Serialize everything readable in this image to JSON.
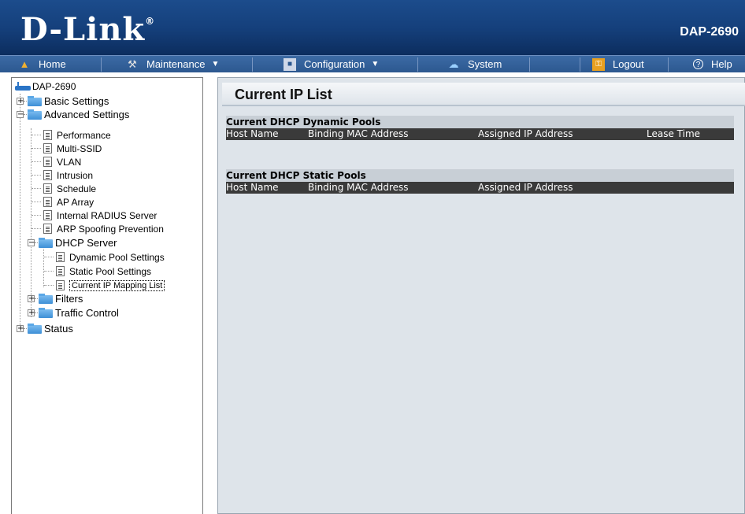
{
  "header": {
    "logo": "D-Link",
    "registered_mark": "®",
    "model": "DAP-2690"
  },
  "menubar": {
    "home": "Home",
    "maintenance": "Maintenance",
    "configuration": "Configuration",
    "system": "System",
    "logout": "Logout",
    "help": "Help"
  },
  "tree": {
    "root": "DAP-2690",
    "basic_settings": "Basic Settings",
    "advanced_settings": "Advanced Settings",
    "performance": "Performance",
    "multi_ssid": "Multi-SSID",
    "vlan": "VLAN",
    "intrusion": "Intrusion",
    "schedule": "Schedule",
    "ap_array": "AP Array",
    "internal_radius": "Internal RADIUS Server",
    "arp_spoofing": "ARP Spoofing Prevention",
    "dhcp_server": "DHCP Server",
    "dynamic_pool": "Dynamic Pool Settings",
    "static_pool": "Static Pool Settings",
    "current_ip_mapping": "Current IP Mapping List",
    "filters": "Filters",
    "traffic_control": "Traffic Control",
    "status": "Status"
  },
  "main": {
    "title": "Current IP List",
    "dynamic": {
      "title": "Current DHCP Dynamic Pools",
      "columns": [
        "Host Name",
        "Binding MAC Address",
        "Assigned IP Address",
        "Lease Time"
      ]
    },
    "static": {
      "title": "Current DHCP Static Pools",
      "columns": [
        "Host Name",
        "Binding MAC Address",
        "Assigned IP Address"
      ]
    }
  }
}
